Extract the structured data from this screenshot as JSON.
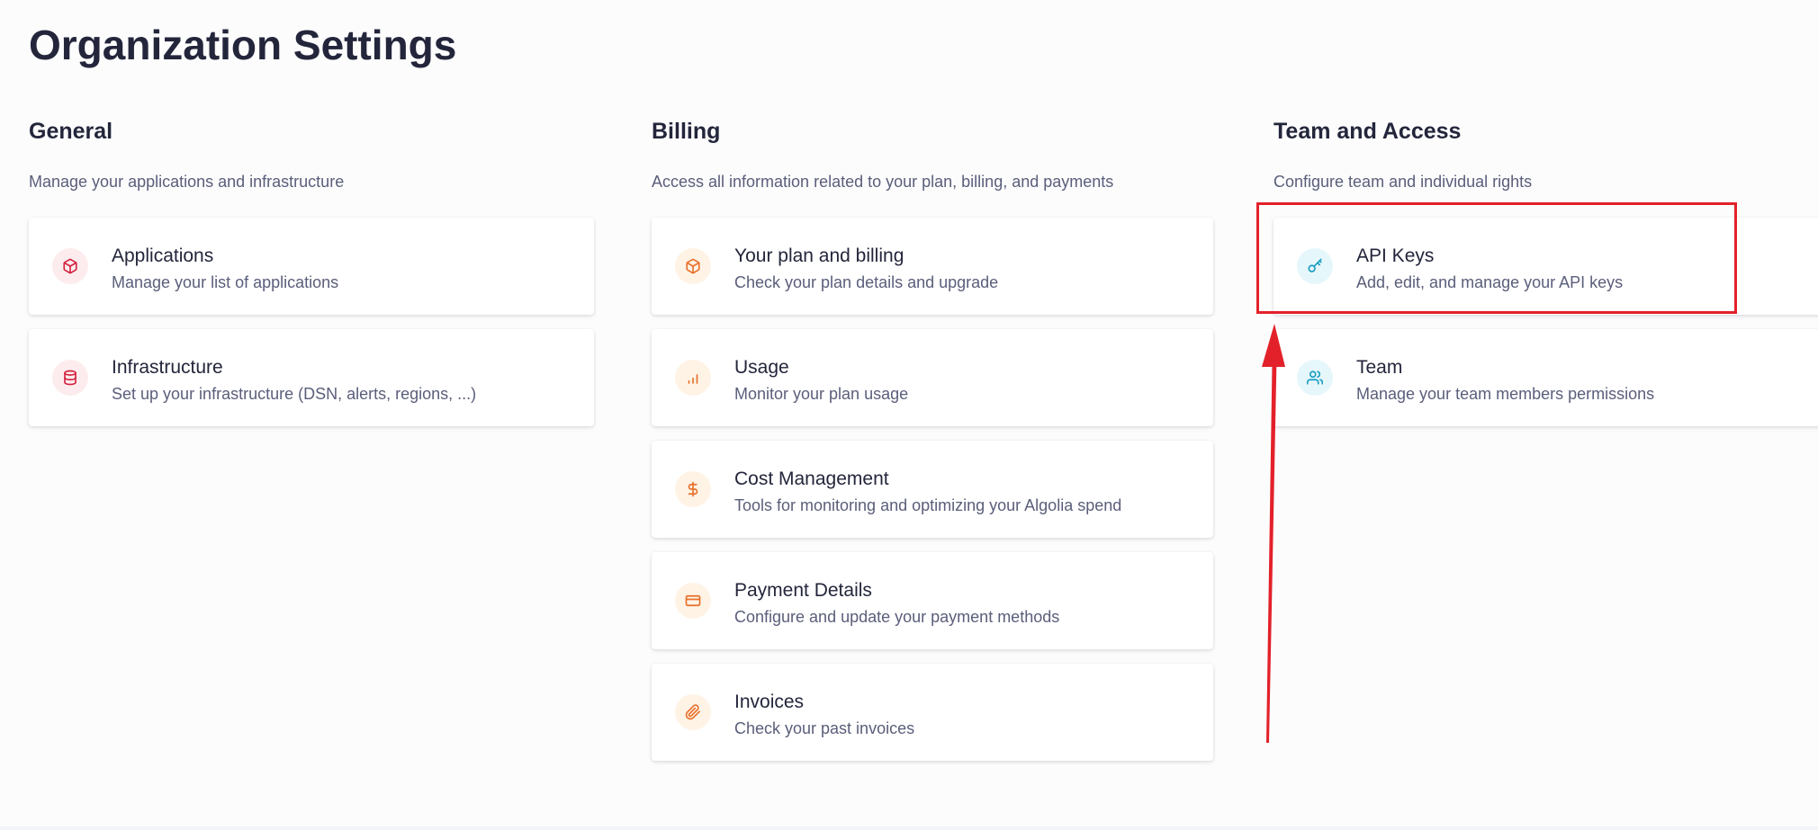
{
  "page": {
    "title": "Organization Settings"
  },
  "sections": {
    "general": {
      "title": "General",
      "description": "Manage your applications and infrastructure",
      "items": [
        {
          "title": "Applications",
          "description": "Manage your list of applications",
          "icon": "cube-icon"
        },
        {
          "title": "Infrastructure",
          "description": "Set up your infrastructure (DSN, alerts, regions, ...)",
          "icon": "database-icon"
        }
      ]
    },
    "billing": {
      "title": "Billing",
      "description": "Access all information related to your plan, billing, and payments",
      "items": [
        {
          "title": "Your plan and billing",
          "description": "Check your plan details and upgrade",
          "icon": "cube-icon"
        },
        {
          "title": "Usage",
          "description": "Monitor your plan usage",
          "icon": "bar-chart-icon"
        },
        {
          "title": "Cost Management",
          "description": "Tools for monitoring and optimizing your Algolia spend",
          "icon": "dollar-icon"
        },
        {
          "title": "Payment Details",
          "description": "Configure and update your payment methods",
          "icon": "credit-card-icon"
        },
        {
          "title": "Invoices",
          "description": "Check your past invoices",
          "icon": "paperclip-icon"
        }
      ]
    },
    "team": {
      "title": "Team and Access",
      "description": "Configure team and individual rights",
      "items": [
        {
          "title": "API Keys",
          "description": "Add, edit, and manage your API keys",
          "icon": "key-icon"
        },
        {
          "title": "Team",
          "description": "Manage your team members permissions",
          "icon": "users-icon"
        }
      ]
    }
  },
  "colors": {
    "general_accent": "#d3223f",
    "billing_accent": "#e8702a",
    "team_accent": "#1b9ec2",
    "annotation": "#e3212a"
  }
}
